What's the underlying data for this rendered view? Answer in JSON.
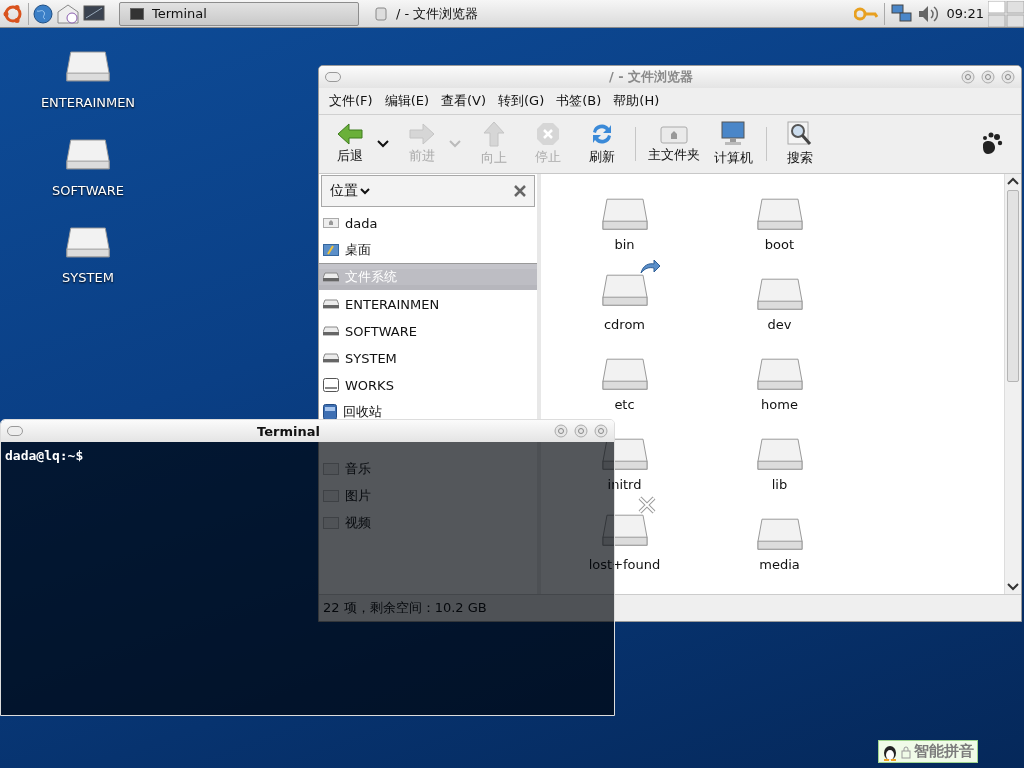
{
  "panel": {
    "tasks": [
      {
        "label": "Terminal",
        "selected": true
      },
      {
        "label": "/ - 文件浏览器",
        "selected": false
      }
    ],
    "clock": "09:21"
  },
  "desktop_icons": [
    {
      "label": "ENTERAINMEN"
    },
    {
      "label": "SOFTWARE"
    },
    {
      "label": "SYSTEM"
    }
  ],
  "file_browser": {
    "title": "/ - 文件浏览器",
    "menu": [
      "文件(F)",
      "编辑(E)",
      "查看(V)",
      "转到(G)",
      "书签(B)",
      "帮助(H)"
    ],
    "toolbar": [
      [
        {
          "label": "后退",
          "kind": "back",
          "disabled": false,
          "has_menu": true
        },
        {
          "label": "前进",
          "kind": "forward",
          "disabled": true,
          "has_menu": true
        },
        {
          "label": "向上",
          "kind": "up",
          "disabled": true,
          "has_menu": false
        },
        {
          "label": "停止",
          "kind": "stop",
          "disabled": true,
          "has_menu": false
        },
        {
          "label": "刷新",
          "kind": "reload",
          "disabled": false,
          "has_menu": false
        }
      ],
      [
        {
          "label": "主文件夹",
          "kind": "home",
          "disabled": false,
          "has_menu": false
        },
        {
          "label": "计算机",
          "kind": "computer",
          "disabled": false,
          "has_menu": false
        }
      ],
      [
        {
          "label": "搜索",
          "kind": "search",
          "disabled": false,
          "has_menu": false
        }
      ]
    ],
    "sidebar": {
      "header": "位置",
      "items": [
        {
          "label": "dada",
          "kind": "home",
          "selected": false
        },
        {
          "label": "桌面",
          "kind": "desktop",
          "selected": false
        },
        {
          "label": "文件系统",
          "kind": "drive",
          "selected": true
        },
        {
          "label": "ENTERAINMEN",
          "kind": "drive",
          "selected": false
        },
        {
          "label": "SOFTWARE",
          "kind": "drive",
          "selected": false
        },
        {
          "label": "SYSTEM",
          "kind": "drive",
          "selected": false
        },
        {
          "label": "WORKS",
          "kind": "removable",
          "selected": false
        },
        {
          "label": "回收站",
          "kind": "trash",
          "selected": false
        }
      ],
      "bookmarks": [
        {
          "label": "音乐",
          "kind": "folder",
          "selected": false
        },
        {
          "label": "图片",
          "kind": "folder",
          "selected": false
        },
        {
          "label": "视频",
          "kind": "folder",
          "selected": false
        }
      ]
    },
    "files": [
      {
        "name": "bin",
        "kind": "folder"
      },
      {
        "name": "boot",
        "kind": "folder"
      },
      {
        "name": "cdrom",
        "kind": "link"
      },
      {
        "name": "dev",
        "kind": "folder"
      },
      {
        "name": "etc",
        "kind": "folder"
      },
      {
        "name": "home",
        "kind": "folder"
      },
      {
        "name": "initrd",
        "kind": "folder"
      },
      {
        "name": "lib",
        "kind": "folder"
      },
      {
        "name": "lost+found",
        "kind": "locked"
      },
      {
        "name": "media",
        "kind": "folder"
      }
    ],
    "status": "22 项，剩余空间：10.2 GB"
  },
  "terminal": {
    "title": "Terminal",
    "prompt": "dada@lq:~$"
  },
  "input_method": {
    "label": "智能拼音"
  }
}
